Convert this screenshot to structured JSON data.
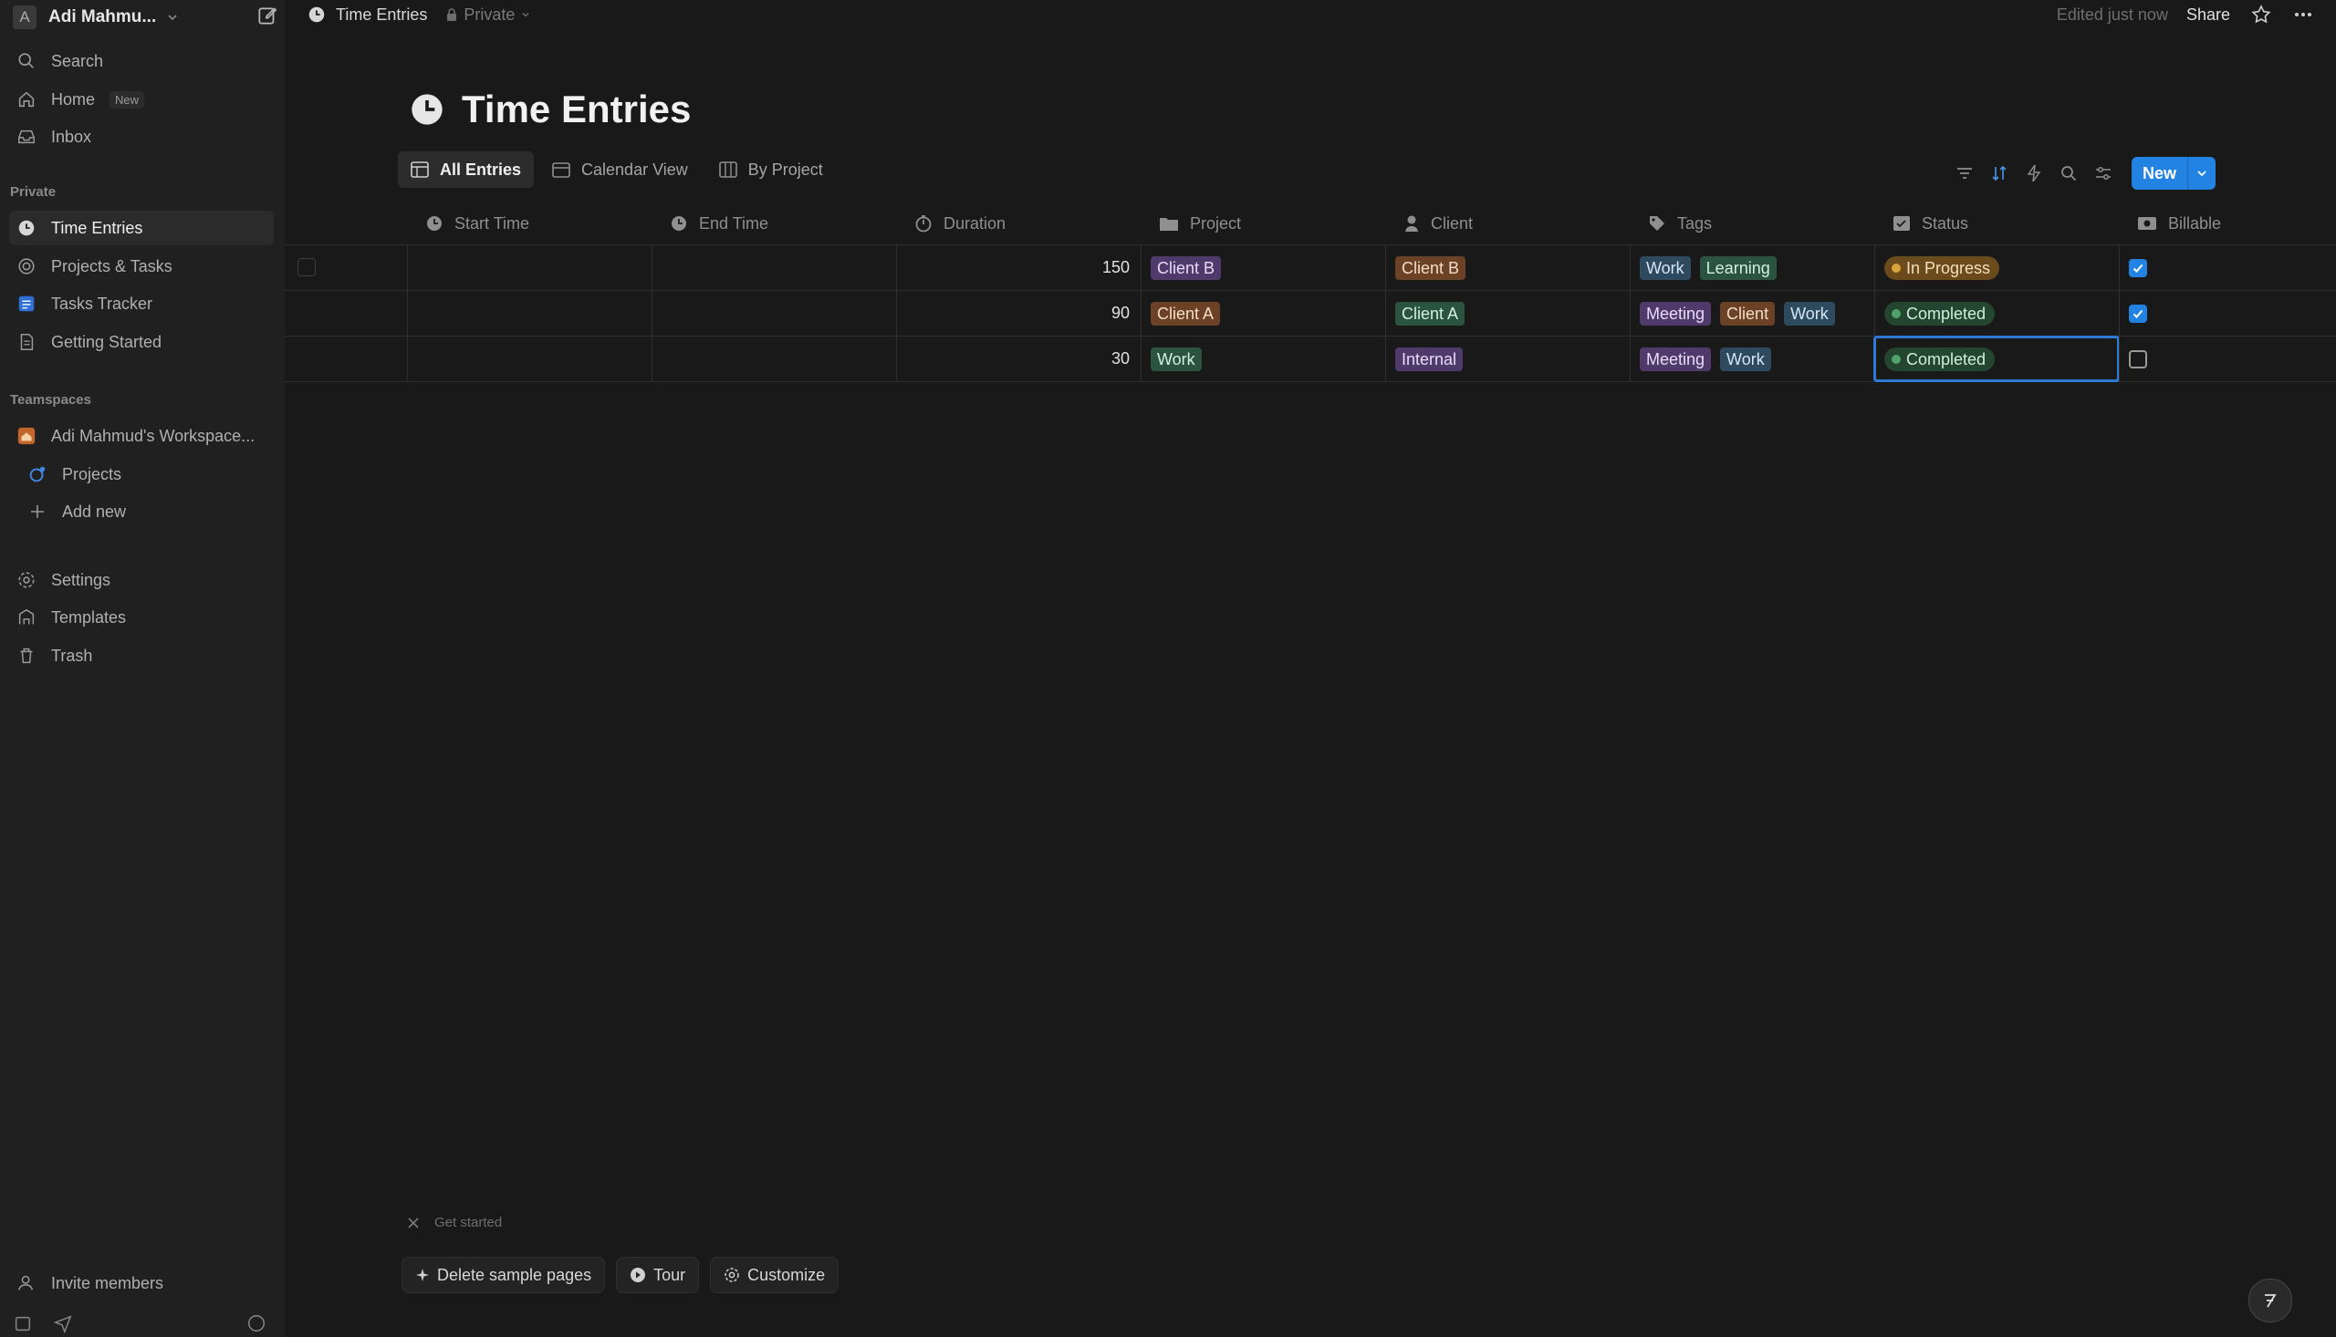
{
  "workspace": {
    "initial": "A",
    "name": "Adi Mahmu..."
  },
  "sidebar": {
    "top_items": [
      {
        "label": "Search",
        "icon": "search-icon"
      },
      {
        "label": "Home",
        "icon": "home-icon",
        "badge": "New"
      },
      {
        "label": "Inbox",
        "icon": "inbox-icon"
      }
    ],
    "private_label": "Private",
    "private_items": [
      {
        "label": "Time Entries",
        "icon": "clock-icon",
        "active": true
      },
      {
        "label": "Projects & Tasks",
        "icon": "target-icon"
      },
      {
        "label": "Tasks Tracker",
        "icon": "checklist-icon"
      },
      {
        "label": "Getting Started",
        "icon": "page-icon"
      }
    ],
    "teamspaces_label": "Teamspaces",
    "teamspace_items": [
      {
        "label": "Adi Mahmud's Workspace...",
        "icon": "house-icon"
      },
      {
        "label": "Projects",
        "icon": "projects-icon"
      },
      {
        "label": "Add new",
        "icon": "plus-icon"
      }
    ],
    "bottom_items": [
      {
        "label": "Settings",
        "icon": "gear-icon"
      },
      {
        "label": "Templates",
        "icon": "templates-icon"
      },
      {
        "label": "Trash",
        "icon": "trash-icon"
      }
    ],
    "invite_label": "Invite members"
  },
  "topbar": {
    "page_name": "Time Entries",
    "visibility": "Private",
    "edited": "Edited just now",
    "share": "Share"
  },
  "page": {
    "title": "Time Entries",
    "views": [
      {
        "label": "All Entries",
        "active": true
      },
      {
        "label": "Calendar View"
      },
      {
        "label": "By Project"
      }
    ],
    "new_button": "New"
  },
  "table": {
    "columns": [
      {
        "label": "Start Time",
        "icon": "clock-icon"
      },
      {
        "label": "End Time",
        "icon": "clock-icon"
      },
      {
        "label": "Duration",
        "icon": "timer-icon"
      },
      {
        "label": "Project",
        "icon": "folder-icon"
      },
      {
        "label": "Client",
        "icon": "person-icon"
      },
      {
        "label": "Tags",
        "icon": "tag-icon"
      },
      {
        "label": "Status",
        "icon": "status-icon"
      },
      {
        "label": "Billable",
        "icon": "billable-icon"
      }
    ],
    "rows": [
      {
        "start": "",
        "end": "",
        "duration": "150",
        "project": {
          "text": "Client B",
          "color": "#4f3a6b"
        },
        "client": {
          "text": "Client B",
          "color": "#6b4226"
        },
        "tags": [
          {
            "text": "Work",
            "color": "#2e4a5f"
          },
          {
            "text": "Learning",
            "color": "#2b5440"
          }
        ],
        "status": {
          "text": "In Progress",
          "bg": "#6b4a1c",
          "dot": "#d9a33c"
        },
        "billable": true
      },
      {
        "start": "",
        "end": "",
        "duration": "90",
        "project": {
          "text": "Client A",
          "color": "#6b4226"
        },
        "client": {
          "text": "Client A",
          "color": "#2b5440"
        },
        "tags": [
          {
            "text": "Meeting",
            "color": "#4f3a6b"
          },
          {
            "text": "Client",
            "color": "#6b4226"
          },
          {
            "text": "Work",
            "color": "#2e4a5f"
          }
        ],
        "status": {
          "text": "Completed",
          "bg": "#24452f",
          "dot": "#4fa26a"
        },
        "billable": true
      },
      {
        "start": "",
        "end": "",
        "duration": "30",
        "project": {
          "text": "Work",
          "color": "#2b5440"
        },
        "client": {
          "text": "Internal",
          "color": "#4f3a6b"
        },
        "tags": [
          {
            "text": "Meeting",
            "color": "#4f3a6b"
          },
          {
            "text": "Work",
            "color": "#2e4a5f"
          }
        ],
        "status": {
          "text": "Completed",
          "bg": "#24452f",
          "dot": "#4fa26a"
        },
        "billable": false
      }
    ]
  },
  "helpers": {
    "get_started": "Get started",
    "delete_label": "Delete sample pages",
    "tour_label": "Tour",
    "customize_label": "Customize"
  },
  "colors": {
    "accent": "#2383e2",
    "sidebar_bg": "#202020",
    "page_bg": "#191919"
  }
}
